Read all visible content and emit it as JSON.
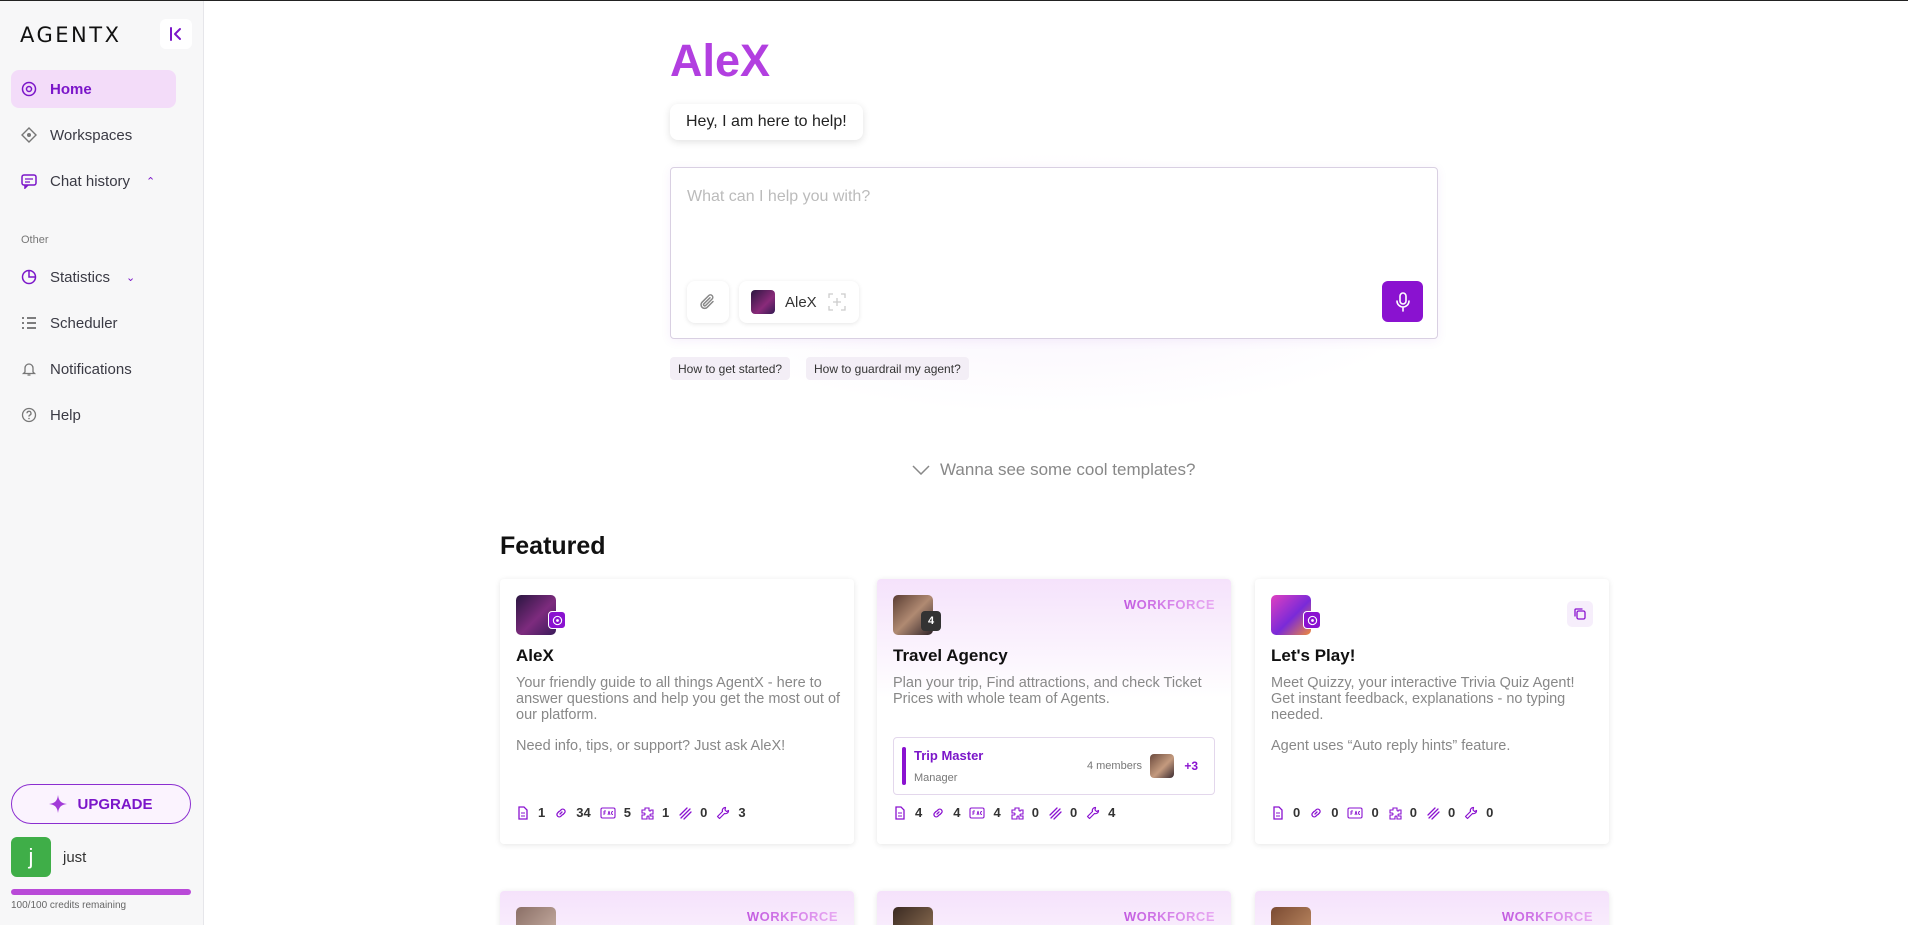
{
  "sidebar": {
    "logo": "AGENTX",
    "collapse_icon": "collapse-left-icon",
    "nav": [
      {
        "label": "Home",
        "icon": "home-icon",
        "active": true
      },
      {
        "label": "Workspaces",
        "icon": "workspaces-icon"
      },
      {
        "label": "Chat history",
        "icon": "chat-history-icon",
        "chevron": "up"
      }
    ],
    "section_other": "Other",
    "other_nav": [
      {
        "label": "Statistics",
        "icon": "statistics-icon",
        "chevron": "down"
      },
      {
        "label": "Scheduler",
        "icon": "scheduler-icon"
      },
      {
        "label": "Notifications",
        "icon": "bell-icon"
      },
      {
        "label": "Help",
        "icon": "help-icon"
      }
    ],
    "upgrade_label": "UPGRADE",
    "user": {
      "initial": "j",
      "name": "just"
    },
    "credits_text": "100/100 credits remaining",
    "credits_fraction": 1.0
  },
  "hero": {
    "title": "AleX",
    "greeting": "Hey, I am here to help!"
  },
  "composer": {
    "placeholder": "What can I help you with?",
    "agent_name": "AleX"
  },
  "suggestions": [
    "How to get started?",
    "How to guardrail my agent?"
  ],
  "templates_label": "Wanna see some cool templates?",
  "featured": {
    "heading": "Featured",
    "cards": [
      {
        "title": "AleX",
        "description": "Your friendly guide to all things AgentX - here to answer questions and help you get the most out of our platform.",
        "extra": "Need info, tips, or support? Just ask AleX!",
        "stats": [
          "1",
          "34",
          "5",
          "1",
          "0",
          "3"
        ]
      },
      {
        "tag": "WORKFORCE",
        "count": "4",
        "title": "Travel Agency",
        "description": "Plan your trip, Find attractions, and check Ticket Prices with whole team of Agents.",
        "team": {
          "name": "Trip Master",
          "role": "Manager",
          "members": "4 members",
          "more": "+3"
        },
        "stats": [
          "4",
          "4",
          "4",
          "0",
          "0",
          "4"
        ]
      },
      {
        "title": "Let's Play!",
        "description": "Meet Quizzy, your interactive Trivia Quiz Agent! Get instant feedback, explanations - no typing needed.",
        "extra": "Agent uses “Auto reply hints” feature.",
        "stats": [
          "0",
          "0",
          "0",
          "0",
          "0",
          "0"
        ]
      }
    ],
    "more_tags": [
      "WORKFORCE",
      "WORKFORCE",
      "WORKFORCE"
    ]
  },
  "colors": {
    "accent": "#8a12d0",
    "title": "#b23fe0",
    "active_bg": "#f3dcf9"
  }
}
